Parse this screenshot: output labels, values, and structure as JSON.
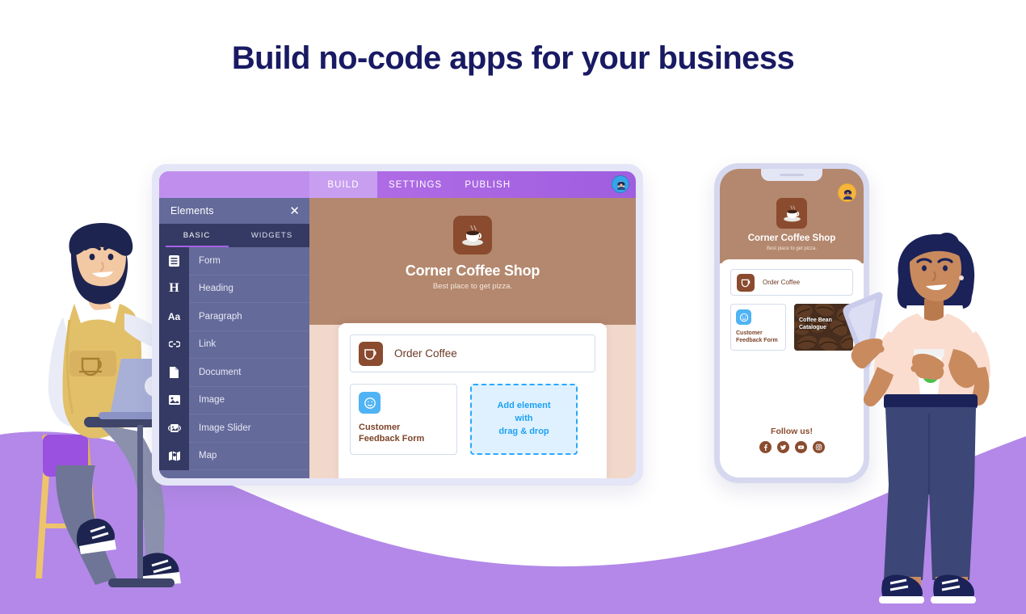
{
  "headline": "Build no-code apps for your business",
  "colors": {
    "headline": "#191a63",
    "wave_purple": "#b388e8",
    "topbar_purple": "#a870e4",
    "sidebar_slate": "#646a9a",
    "sidebar_dark": "#343a63",
    "accent_purple": "#a561e8",
    "hero_brown": "#b4886e",
    "canvas_peach": "#f1d8cb",
    "tile_brown": "#8a4b2f",
    "blue_accent": "#29a9f8",
    "dropzone_fill": "#dff1fe",
    "label_brown": "#7c4428"
  },
  "builder": {
    "topbar": {
      "tabs": [
        {
          "label": "BUILD",
          "active": true
        },
        {
          "label": "SETTINGS",
          "active": false
        },
        {
          "label": "PUBLISH",
          "active": false
        }
      ],
      "avatar_icon": "user-avatar-icon"
    },
    "sidebar": {
      "title": "Elements",
      "close_icon": "close-icon",
      "tabs": [
        {
          "label": "BASIC",
          "active": true
        },
        {
          "label": "WIDGETS",
          "active": false
        }
      ],
      "items": [
        {
          "label": "Form",
          "icon": "form-icon",
          "glyph": "☰"
        },
        {
          "label": "Heading",
          "icon": "heading-icon",
          "glyph": "H"
        },
        {
          "label": "Paragraph",
          "icon": "paragraph-icon",
          "glyph": "Aa"
        },
        {
          "label": "Link",
          "icon": "link-icon",
          "glyph": "⚭"
        },
        {
          "label": "Document",
          "icon": "document-icon",
          "glyph": "☷"
        },
        {
          "label": "Image",
          "icon": "image-icon",
          "glyph": "▣"
        },
        {
          "label": "Image Slider",
          "icon": "image-slider-icon",
          "glyph": "⧉"
        },
        {
          "label": "Map",
          "icon": "map-icon",
          "glyph": "▥"
        }
      ]
    },
    "canvas": {
      "logo_icon": "coffee-cup-logo",
      "shop_name": "Corner Coffee Shop",
      "tagline": "Best place to get pizza.",
      "order_item": {
        "label": "Order Coffee",
        "icon": "coffee-mug-icon"
      },
      "feedback_card": {
        "label": "Customer\nFeedback Form",
        "line1": "Customer",
        "line2": "Feedback Form",
        "icon": "smiley-face-icon"
      },
      "drop_zone": {
        "line1": "Add element",
        "line2": "with",
        "line3": "drag & drop"
      }
    }
  },
  "phone": {
    "avatar_icon": "user-avatar-icon",
    "logo_icon": "coffee-cup-logo",
    "shop_name": "Corner Coffee Shop",
    "tagline": "Best place to get pizza.",
    "order_item": {
      "label": "Order Coffee",
      "icon": "coffee-mug-icon"
    },
    "feedback_card": {
      "line1": "Customer",
      "line2": "Feedback Form",
      "icon": "smiley-face-icon"
    },
    "catalogue_card": {
      "line1": "Coffee Bean",
      "line2": "Catalogue",
      "icon": "coffee-beans-photo"
    },
    "follow": {
      "label": "Follow us!",
      "socials": [
        {
          "name": "facebook-icon"
        },
        {
          "name": "twitter-icon"
        },
        {
          "name": "youtube-icon"
        },
        {
          "name": "instagram-icon"
        }
      ]
    }
  },
  "illustration": {
    "left_person": "bearded-man-with-laptop",
    "right_person": "woman-with-phone-and-coffee"
  }
}
